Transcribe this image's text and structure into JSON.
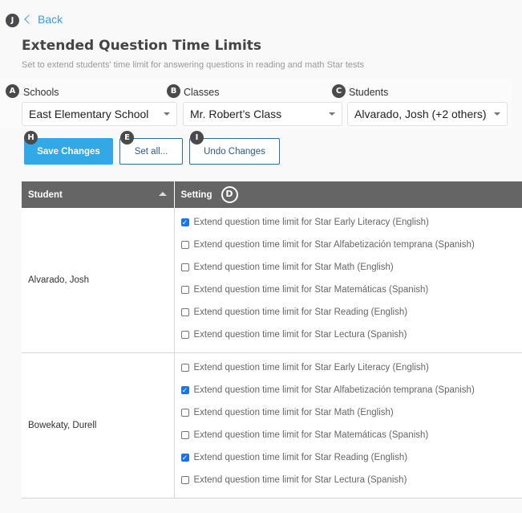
{
  "markers": {
    "back": "J",
    "schools": "A",
    "classes": "B",
    "students": "C",
    "setting": "D",
    "set_all": "E",
    "save": "H",
    "undo": "I"
  },
  "nav": {
    "back_label": "Back"
  },
  "header": {
    "title": "Extended Question Time Limits",
    "subtitle": "Set to extend students' time limit for answering questions in reading and math Star tests"
  },
  "filters": {
    "schools": {
      "label": "Schools",
      "value": "East Elementary School"
    },
    "classes": {
      "label": "Classes",
      "value": "Mr. Robert’s Class"
    },
    "students": {
      "label": "Students",
      "value": "Alvarado, Josh (+2 others)"
    }
  },
  "toolbar": {
    "save_label": "Save Changes",
    "set_all_label": "Set all...",
    "undo_label": "Undo Changes"
  },
  "table": {
    "columns": {
      "student": "Student",
      "setting": "Setting"
    },
    "rows": [
      {
        "student": "Alvarado, Josh",
        "options": [
          {
            "label": "Extend question time limit for Star Early Literacy (English)",
            "checked": true
          },
          {
            "label": "Extend question time limit for Star Alfabetización temprana (Spanish)",
            "checked": false
          },
          {
            "label": "Extend question time limit for Star Math (English)",
            "checked": false
          },
          {
            "label": "Extend question time limit for Star Matemáticas (Spanish)",
            "checked": false
          },
          {
            "label": "Extend question time limit for Star Reading (English)",
            "checked": false
          },
          {
            "label": "Extend question time limit for Star Lectura (Spanish)",
            "checked": false
          }
        ]
      },
      {
        "student": "Bowekaty, Durell",
        "options": [
          {
            "label": "Extend question time limit for Star Early Literacy (English)",
            "checked": false
          },
          {
            "label": "Extend question time limit for Star Alfabetización temprana (Spanish)",
            "checked": true
          },
          {
            "label": "Extend question time limit for Star Math (English)",
            "checked": false
          },
          {
            "label": "Extend question time limit for Star Matemáticas (Spanish)",
            "checked": false
          },
          {
            "label": "Extend question time limit for Star Reading (English)",
            "checked": true
          },
          {
            "label": "Extend question time limit for Star Lectura (Spanish)",
            "checked": false
          }
        ]
      }
    ]
  }
}
